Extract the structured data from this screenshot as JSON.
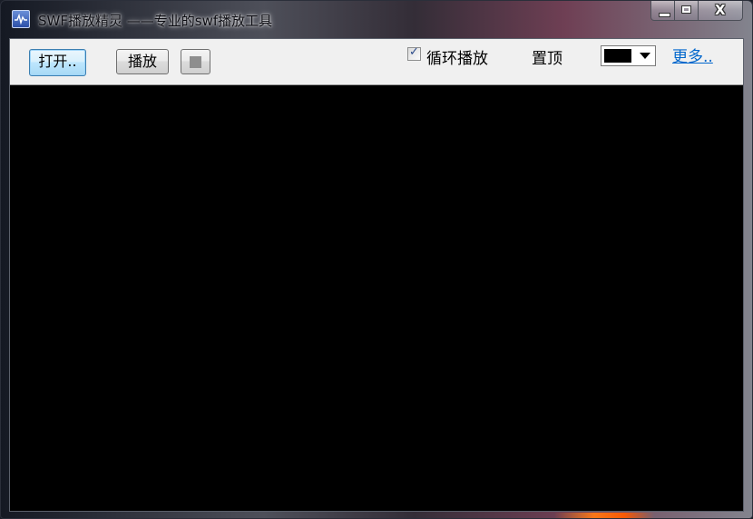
{
  "window": {
    "title": "SWF播放精灵 ——专业的swf播放工具",
    "icon": "swf-app-icon",
    "caption_buttons": {
      "minimize": "minimize-icon",
      "maximize": "maximize-icon",
      "close": "X"
    }
  },
  "toolbar": {
    "open_label": "打开..",
    "play_label": "播放",
    "stop_icon": "stop-square-icon",
    "loop": {
      "label": "循环播放",
      "checked": true,
      "check_mark": "✓"
    },
    "topmost_label": "置顶",
    "background_color": {
      "selected": "#000000"
    },
    "more_label": "更多.."
  },
  "colors": {
    "player_background": "#000000",
    "link": "#0066cc",
    "toolbar_bg": "#f0f0f0"
  }
}
